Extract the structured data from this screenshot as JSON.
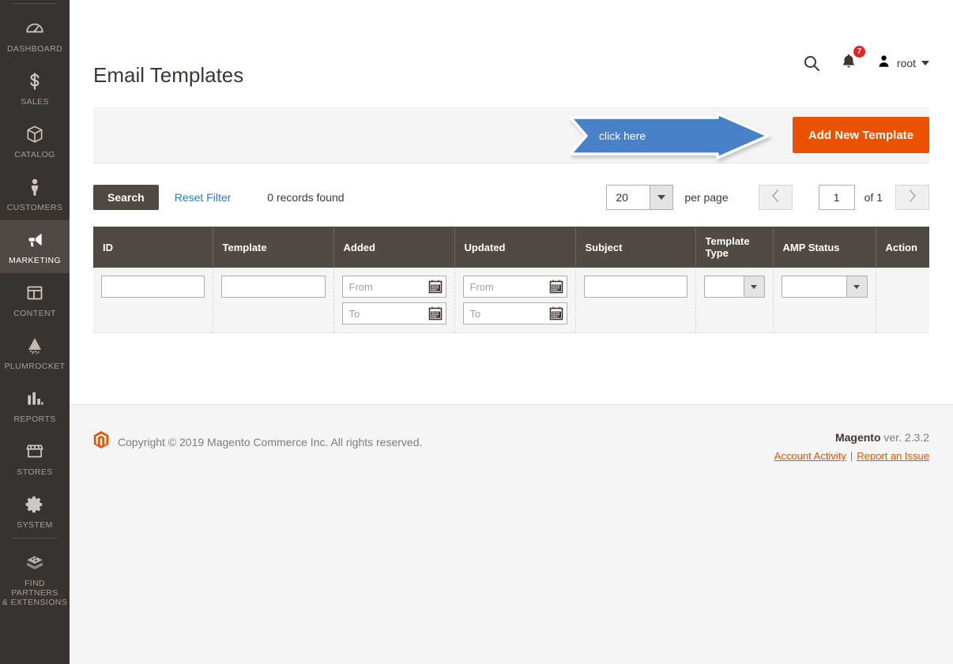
{
  "sidebar": {
    "items": [
      {
        "label": "DASHBOARD",
        "icon": "dashboard-gauge-icon",
        "active": false
      },
      {
        "label": "SALES",
        "icon": "dollar-sign-icon",
        "active": false
      },
      {
        "label": "CATALOG",
        "icon": "box-icon",
        "active": false
      },
      {
        "label": "CUSTOMERS",
        "icon": "person-icon",
        "active": false
      },
      {
        "label": "MARKETING",
        "icon": "megaphone-icon",
        "active": true
      },
      {
        "label": "CONTENT",
        "icon": "layout-panel-icon",
        "active": false
      },
      {
        "label": "PLUMROCKET",
        "icon": "plumrocket-logo-icon",
        "active": false
      },
      {
        "label": "REPORTS",
        "icon": "bar-chart-icon",
        "active": false
      },
      {
        "label": "STORES",
        "icon": "storefront-icon",
        "active": false
      },
      {
        "label": "SYSTEM",
        "icon": "gear-icon",
        "active": false
      },
      {
        "label": "FIND PARTNERS\n& EXTENSIONS",
        "icon": "extension-block-icon",
        "active": false
      }
    ],
    "find_partners_line1": "FIND PARTNERS",
    "find_partners_line2": "& EXTENSIONS"
  },
  "header": {
    "title": "Email Templates",
    "search_icon": "search-icon",
    "notifications_icon": "bell-icon",
    "notifications_count": "7",
    "user_icon": "user-avatar-icon",
    "user_name": "root"
  },
  "action_bar": {
    "add_new_template_label": "Add New Template",
    "annotation_label": "click here",
    "annotation_color": "#4a81c8",
    "button_color": "#eb5202"
  },
  "toolbar": {
    "search_label": "Search",
    "reset_filter_label": "Reset Filter",
    "records_found": "0 records found",
    "per_page_value": "20",
    "per_page_label": "per page",
    "page_value": "1",
    "of_pages": "of 1",
    "prev_icon": "chevron-left-icon",
    "next_icon": "chevron-right-icon"
  },
  "grid": {
    "columns": [
      {
        "label": "ID"
      },
      {
        "label": "Template"
      },
      {
        "label": "Added"
      },
      {
        "label": "Updated"
      },
      {
        "label": "Subject"
      },
      {
        "label": "Template Type"
      },
      {
        "label": "AMP Status"
      },
      {
        "label": "Action"
      }
    ],
    "filters": {
      "id_value": "",
      "template_value": "",
      "added_from_placeholder": "From",
      "added_to_placeholder": "To",
      "updated_from_placeholder": "From",
      "updated_to_placeholder": "To",
      "subject_value": "",
      "template_type_value": "",
      "amp_status_value": "",
      "calendar_icon": "calendar-icon"
    }
  },
  "footer": {
    "logo_icon": "magento-logo-icon",
    "copyright": "Copyright © 2019 Magento Commerce Inc. All rights reserved.",
    "brand": "Magento",
    "version": " ver. 2.3.2",
    "account_activity_label": "Account Activity",
    "separator": "|",
    "report_issue_label": "Report an Issue"
  }
}
